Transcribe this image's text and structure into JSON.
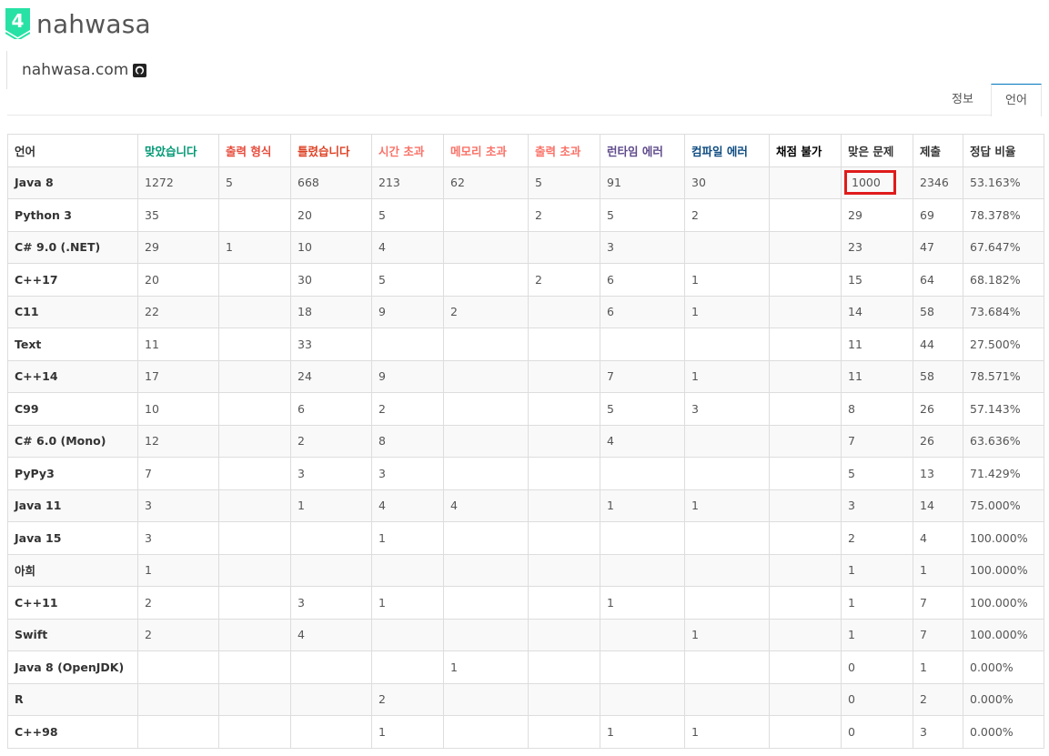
{
  "profile": {
    "tier_number": "4",
    "username": "nahwasa",
    "bio_link": "nahwasa.com",
    "badge_color": "#27e2a4"
  },
  "tabs": [
    {
      "label": "정보",
      "active": false
    },
    {
      "label": "언어",
      "active": true
    }
  ],
  "table": {
    "headers": [
      {
        "label": "언어",
        "color": "#333333"
      },
      {
        "label": "맞았습니다",
        "color": "#009874"
      },
      {
        "label": "출력 형식",
        "color": "#e74c3c"
      },
      {
        "label": "틀렸습니다",
        "color": "#dd4124"
      },
      {
        "label": "시간 초과",
        "color": "#fa7268"
      },
      {
        "label": "메모리 초과",
        "color": "#fa7268"
      },
      {
        "label": "출력 초과",
        "color": "#fa7268"
      },
      {
        "label": "런타임 에러",
        "color": "#5f4b8b"
      },
      {
        "label": "컴파일 에러",
        "color": "#0f4c81"
      },
      {
        "label": "채점 불가",
        "color": "#000000"
      },
      {
        "label": "맞은 문제",
        "color": "#333333"
      },
      {
        "label": "제출",
        "color": "#333333"
      },
      {
        "label": "정답 비율",
        "color": "#333333"
      }
    ],
    "highlight": {
      "row": 0,
      "col": 10,
      "color": "#e01b1b"
    },
    "rows": [
      [
        "Java 8",
        "1272",
        "5",
        "668",
        "213",
        "62",
        "5",
        "91",
        "30",
        "",
        "1000",
        "2346",
        "53.163%"
      ],
      [
        "Python 3",
        "35",
        "",
        "20",
        "5",
        "",
        "2",
        "5",
        "2",
        "",
        "29",
        "69",
        "78.378%"
      ],
      [
        "C# 9.0 (.NET)",
        "29",
        "1",
        "10",
        "4",
        "",
        "",
        "3",
        "",
        "",
        "23",
        "47",
        "67.647%"
      ],
      [
        "C++17",
        "20",
        "",
        "30",
        "5",
        "",
        "2",
        "6",
        "1",
        "",
        "15",
        "64",
        "68.182%"
      ],
      [
        "C11",
        "22",
        "",
        "18",
        "9",
        "2",
        "",
        "6",
        "1",
        "",
        "14",
        "58",
        "73.684%"
      ],
      [
        "Text",
        "11",
        "",
        "33",
        "",
        "",
        "",
        "",
        "",
        "",
        "11",
        "44",
        "27.500%"
      ],
      [
        "C++14",
        "17",
        "",
        "24",
        "9",
        "",
        "",
        "7",
        "1",
        "",
        "11",
        "58",
        "78.571%"
      ],
      [
        "C99",
        "10",
        "",
        "6",
        "2",
        "",
        "",
        "5",
        "3",
        "",
        "8",
        "26",
        "57.143%"
      ],
      [
        "C# 6.0 (Mono)",
        "12",
        "",
        "2",
        "8",
        "",
        "",
        "4",
        "",
        "",
        "7",
        "26",
        "63.636%"
      ],
      [
        "PyPy3",
        "7",
        "",
        "3",
        "3",
        "",
        "",
        "",
        "",
        "",
        "5",
        "13",
        "71.429%"
      ],
      [
        "Java 11",
        "3",
        "",
        "1",
        "4",
        "4",
        "",
        "1",
        "1",
        "",
        "3",
        "14",
        "75.000%"
      ],
      [
        "Java 15",
        "3",
        "",
        "",
        "1",
        "",
        "",
        "",
        "",
        "",
        "2",
        "4",
        "100.000%"
      ],
      [
        "아희",
        "1",
        "",
        "",
        "",
        "",
        "",
        "",
        "",
        "",
        "1",
        "1",
        "100.000%"
      ],
      [
        "C++11",
        "2",
        "",
        "3",
        "1",
        "",
        "",
        "1",
        "",
        "",
        "1",
        "7",
        "100.000%"
      ],
      [
        "Swift",
        "2",
        "",
        "4",
        "",
        "",
        "",
        "",
        "1",
        "",
        "1",
        "7",
        "100.000%"
      ],
      [
        "Java 8 (OpenJDK)",
        "",
        "",
        "",
        "",
        "1",
        "",
        "",
        "",
        "",
        "0",
        "1",
        "0.000%"
      ],
      [
        "R",
        "",
        "",
        "",
        "2",
        "",
        "",
        "",
        "",
        "",
        "0",
        "2",
        "0.000%"
      ],
      [
        "C++98",
        "",
        "",
        "",
        "1",
        "",
        "",
        "1",
        "1",
        "",
        "0",
        "3",
        "0.000%"
      ]
    ]
  }
}
